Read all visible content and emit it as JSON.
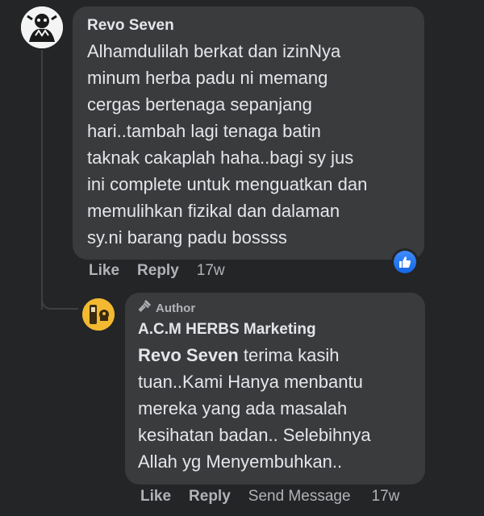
{
  "main_comment": {
    "author": "Revo Seven",
    "text": "Alhamdulilah berkat dan izinNya\nminum herba padu ni memang\ncergas bertenaga sepanjang\nhari..tambah lagi tenaga batin\ntaknak cakaplah haha..bagi sy jus\nini complete untuk menguatkan dan\nmemulihkan fizikal dan dalaman\nsy.ni barang padu bossss",
    "actions": {
      "like": "Like",
      "reply": "Reply",
      "time": "17w"
    },
    "reaction_icon": "thumbs-up-icon",
    "reaction_color": "#1877f2"
  },
  "reply_comment": {
    "badge": "Author",
    "badge_icon": "microphone-icon",
    "author": "A.C.M HERBS Marketing",
    "mention": "Revo Seven",
    "text": " terima kasih\ntuan..Kami Hanya menbantu\nmereka yang ada masalah\nkesihatan badan.. Selebihnya\nAllah yg Menyembuhkan..",
    "actions": {
      "like": "Like",
      "reply": "Reply",
      "send_message": "Send Message",
      "time": "17w"
    }
  }
}
